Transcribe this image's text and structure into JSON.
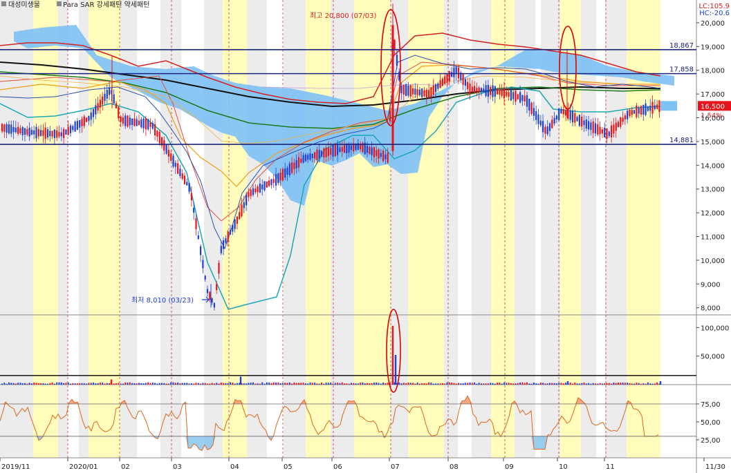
{
  "chart_data": {
    "type": "candlestick",
    "legend": [
      "대성미생물",
      "Para SAR 강세패턴 약세패턴"
    ],
    "indicator_labels": [
      "LC:105.9",
      "HC:-20.6"
    ],
    "x_ticks": [
      "2019/11",
      "2020/01",
      "02",
      "03",
      "04",
      "05",
      "06",
      "07",
      "08",
      "09",
      "10",
      "11",
      "11/30"
    ],
    "price_axis": {
      "ylim": [
        7700,
        20900
      ],
      "ticks": [
        8000,
        9000,
        10000,
        11000,
        12000,
        13000,
        14000,
        15000,
        16000,
        17000,
        18000,
        19000,
        20000
      ],
      "tick_labels": [
        "8,000",
        "9,000",
        "10,000",
        "11,000",
        "12,000",
        "13,000",
        "14,000",
        "15,000",
        "16,000",
        "17,000",
        "18,000",
        "19,000",
        "20,000"
      ]
    },
    "volume_axis": {
      "ylim": [
        0,
        115000
      ],
      "ticks": [
        50000,
        100000
      ],
      "tick_labels": [
        "50,000",
        "100,000"
      ]
    },
    "oscillator_axis": {
      "ylim": [
        0,
        100
      ],
      "ticks": [
        25,
        50,
        75
      ],
      "tick_labels": [
        "25,00",
        "50,00",
        "75,00"
      ]
    },
    "horizontal_levels": [
      {
        "value": 18867,
        "label": "18,867"
      },
      {
        "value": 17858,
        "label": "17,858"
      },
      {
        "value": 14881,
        "label": "14,881"
      }
    ],
    "current_price": {
      "value": 16500,
      "label": "16,500",
      "change": "1.54%"
    },
    "annotations": {
      "high": "최고 20,800 (07/03)",
      "low": "최저 8,010 (03/23)"
    },
    "colors": {
      "up": "#e8141b",
      "down": "#1f3fd6",
      "band": "#7ec1f5",
      "highlight": "#fffcbc"
    }
  }
}
